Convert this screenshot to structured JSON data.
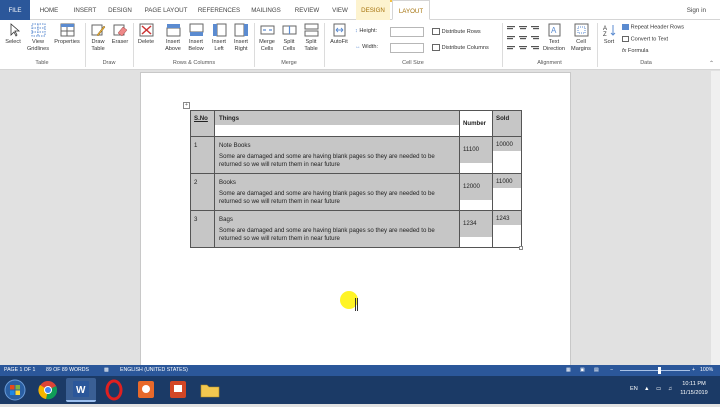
{
  "tabs": [
    {
      "label": "FILE"
    },
    {
      "label": "HOME"
    },
    {
      "label": "INSERT"
    },
    {
      "label": "DESIGN"
    },
    {
      "label": "PAGE LAYOUT"
    },
    {
      "label": "REFERENCES"
    },
    {
      "label": "MAILINGS"
    },
    {
      "label": "REVIEW"
    },
    {
      "label": "VIEW"
    },
    {
      "label": "DESIGN"
    },
    {
      "label": "LAYOUT"
    }
  ],
  "signin": "Sign in",
  "ribbon": {
    "select": "Select",
    "view_gridlines_1": "View",
    "view_gridlines_2": "Gridlines",
    "properties": "Properties",
    "draw_table_1": "Draw",
    "draw_table_2": "Table",
    "eraser": "Eraser",
    "delete": "Delete",
    "insert_above_1": "Insert",
    "insert_above_2": "Above",
    "insert_below_1": "Insert",
    "insert_below_2": "Below",
    "insert_left_1": "Insert",
    "insert_left_2": "Left",
    "insert_right_1": "Insert",
    "insert_right_2": "Right",
    "merge_cells_1": "Merge",
    "merge_cells_2": "Cells",
    "split_cells_1": "Split",
    "split_cells_2": "Cells",
    "split_table_1": "Split",
    "split_table_2": "Table",
    "autofit": "AutoFit",
    "height": "Height:",
    "width": "Width:",
    "distribute_rows": "Distribute Rows",
    "distribute_columns": "Distribute Columns",
    "text_direction_1": "Text",
    "text_direction_2": "Direction",
    "cell_margins_1": "Cell",
    "cell_margins_2": "Margins",
    "sort": "Sort",
    "repeat_header_rows": "Repeat Header Rows",
    "convert_to_text": "Convert to Text",
    "formula": "Formula",
    "groups": {
      "table": "Table",
      "draw": "Draw",
      "rows_columns": "Rows & Columns",
      "merge": "Merge",
      "cell_size": "Cell Size",
      "alignment": "Alignment",
      "data": "Data"
    }
  },
  "table": {
    "headers": {
      "sno": "S.No",
      "things": "Things",
      "number": "Number",
      "sold": "Sold"
    },
    "rows": [
      {
        "sno": "1",
        "title": "Note Books",
        "note": "Some are damaged and some are having blank pages so they are needed to be returned so we will return them in near future",
        "number": "11100",
        "sold": "10000"
      },
      {
        "sno": "2",
        "title": "Books",
        "note": "Some are damaged and some are having blank pages so they are needed to be returned so we will return them in near future",
        "number": "12000",
        "sold": "11000"
      },
      {
        "sno": "3",
        "title": "Bags",
        "note": "Some are damaged and some are having blank pages so they are needed to be returned so we will return them in near future",
        "number": "1234",
        "sold": "1243"
      }
    ]
  },
  "status": {
    "page": "PAGE 1 OF 1",
    "words": "89 OF 89 WORDS",
    "language": "ENGLISH (UNITED STATES)",
    "zoom": "100%"
  },
  "taskbar": {
    "lang": "EN",
    "time": "10:11 PM",
    "date": "11/15/2019"
  },
  "colors": {
    "accent": "#2b579a",
    "context_tab": "#a4710a",
    "cell_shade": "#c6c6c6",
    "cursor_highlight": "#fff200"
  }
}
